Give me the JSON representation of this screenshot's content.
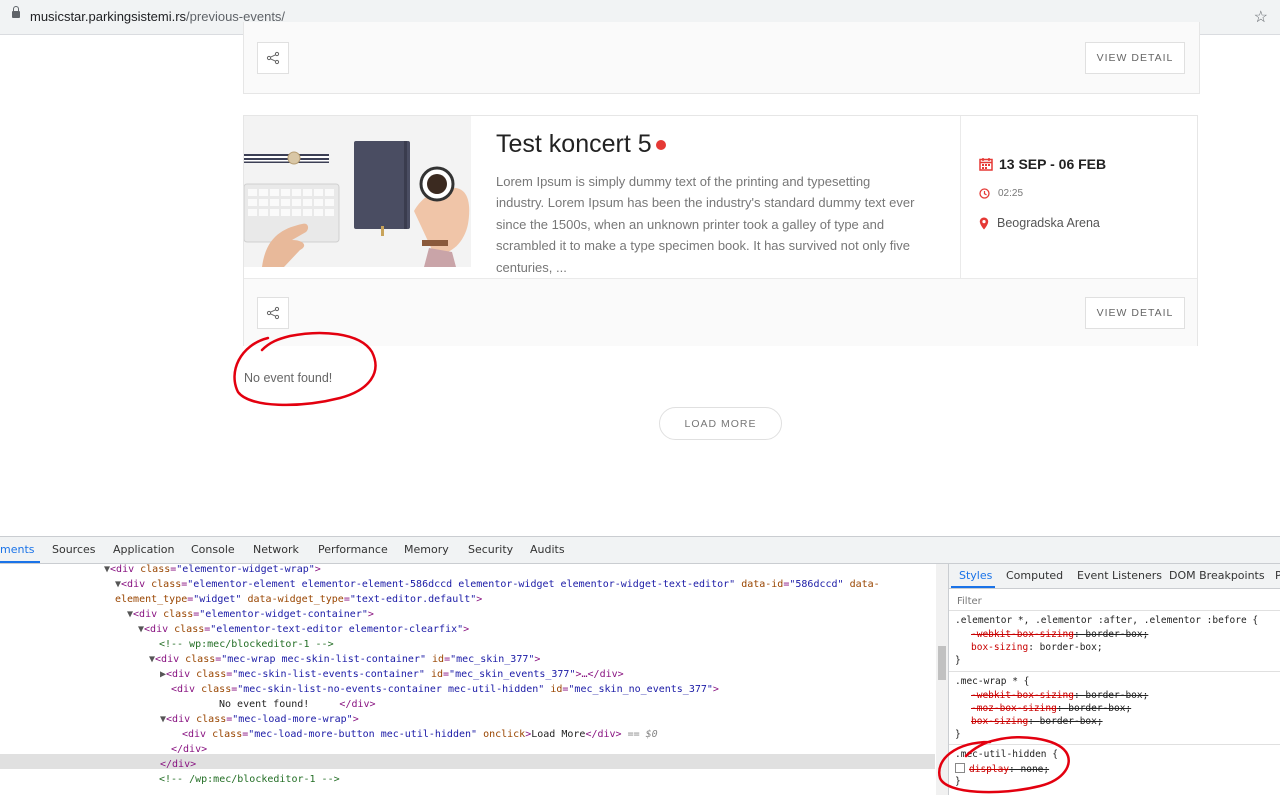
{
  "browser": {
    "url_host": "musicstar.parkingsistemi.rs",
    "url_path": "/previous-events/"
  },
  "prev_card": {
    "view_detail": "VIEW DETAIL"
  },
  "event": {
    "title": "Test koncert 5",
    "description": "Lorem Ipsum is simply dummy text of the printing and typesetting industry. Lorem Ipsum has been the industry's standard dummy text ever since the 1500s, when an unknown printer took a galley of type and scrambled it to make a type specimen book. It has survived not only five centuries, ...",
    "date": "13 SEP - 06 FEB",
    "time": "02:25",
    "location": "Beogradska Arena",
    "view_detail": "VIEW DETAIL"
  },
  "no_event_text": "No event found!",
  "load_more": "LOAD MORE",
  "colors": {
    "accent_red": "#e53935",
    "annotation_red": "#e3000f",
    "devtools_blue": "#1a73e8"
  },
  "devtools": {
    "tabs": [
      "ments",
      "Sources",
      "Application",
      "Console",
      "Network",
      "Performance",
      "Memory",
      "Security",
      "Audits"
    ],
    "dom_lines": [
      {
        "tri": "▼",
        "tag_open": "<div ",
        "attr": "class",
        "val": "\"elementor-widget-wrap\"",
        "tag_close": ">"
      },
      {
        "tri": "▼",
        "tag_open": "<div ",
        "attr": "class",
        "val": "\"elementor-element elementor-element-586dccd elementor-widget elementor-widget-text-editor\"",
        "attr2": "data-id",
        "val2": "\"586dccd\"",
        "attr3": "data-"
      },
      {
        "cont": "element_type",
        "val": "\"widget\"",
        "attr2": "data-widget_type",
        "val2": "\"text-editor.default\""
      },
      {
        "tri": "▼",
        "tag_open": "<div ",
        "attr": "class",
        "val": "\"elementor-widget-container\"",
        "tag_close": ">"
      },
      {
        "tri": "▼",
        "tag_open": "<div ",
        "attr": "class",
        "val": "\"elementor-text-editor elementor-clearfix\"",
        "tag_close": ">"
      },
      {
        "comment": "<!-- wp:mec/blockeditor-1 -->"
      },
      {
        "tri": "▼",
        "tag_open": "<div ",
        "attr": "class",
        "val": "\"mec-wrap mec-skin-list-container\"",
        "attr2": "id",
        "val2": "\"mec_skin_377\"",
        "tag_close": ">"
      },
      {
        "tri": "▶",
        "tag_open": "<div ",
        "attr": "class",
        "val": "\"mec-skin-list-events-container\"",
        "attr2": "id",
        "val2": "\"mec_skin_events_377\"",
        "tag_close": ">…</div>"
      },
      {
        "tag_open": "<div ",
        "attr": "class",
        "val": "\"mec-skin-list-no-events-container mec-util-hidden\"",
        "attr2": "id",
        "val2": "\"mec_skin_no_events_377\"",
        "tag_close": ">"
      },
      {
        "text": "No event found!",
        "tag_close": "</div>"
      },
      {
        "tri": "▼",
        "tag_open": "<div ",
        "attr": "class",
        "val": "\"mec-load-more-wrap\"",
        "tag_close": ">"
      },
      {
        "tag_open": "<div ",
        "attr": "class",
        "val": "\"mec-load-more-button mec-util-hidden\"",
        "attr2": "onclick",
        "text": "Load More",
        "tag_close": "</div>",
        "suffix": "== $0"
      },
      {
        "tag_close": "</div>"
      },
      {
        "tag_close": "</div>"
      },
      {
        "comment": "<!-- /wp:mec/blockeditor-1 -->"
      }
    ],
    "styles_tabs": [
      "Styles",
      "Computed",
      "Event Listeners",
      "DOM Breakpoints",
      "P"
    ],
    "filter_placeholder": "Filter",
    "rules": [
      {
        "selector": ".elementor *, .elementor :after, .elementor :before {",
        "decls": [
          {
            "prop": "-webkit-box-sizing",
            "value": "border-box;",
            "struck": true
          },
          {
            "prop": "box-sizing",
            "value": "border-box;",
            "struck": false
          }
        ],
        "close": "}"
      },
      {
        "selector": ".mec-wrap * {",
        "decls": [
          {
            "prop": "-webkit-box-sizing",
            "value": "border-box;",
            "struck": true
          },
          {
            "prop": "-moz-box-sizing",
            "value": "border-box;",
            "struck": true
          },
          {
            "prop": "box-sizing",
            "value": "border-box;",
            "struck": true
          }
        ],
        "close": "}"
      },
      {
        "selector": ".mec-util-hidden {",
        "decls": [
          {
            "prop": "display",
            "value": "none;",
            "struck": true,
            "checkbox": true
          }
        ],
        "close": "}"
      }
    ]
  }
}
